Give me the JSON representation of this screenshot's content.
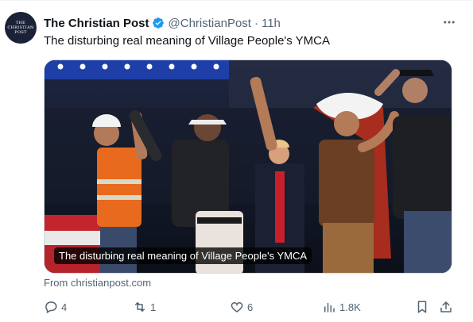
{
  "tweet": {
    "avatar_logo": "THE CHRISTIAN POST",
    "display_name": "The Christian Post",
    "handle": "@ChristianPost",
    "separator": "·",
    "time": "11h",
    "text": "The disturbing real meaning of Village People's YMCA",
    "card_caption": "The disturbing real meaning of Village People's YMCA",
    "card_image_icon": "photo-of-performers-on-stage",
    "source": "From christianpost.com",
    "more_icon": "more-horizontal-icon"
  },
  "actions": {
    "replies": "4",
    "retweets": "1",
    "likes": "6",
    "views": "1.8K",
    "bookmark_icon": "bookmark-icon",
    "share_icon": "share-icon"
  },
  "colors": {
    "text": "#0f1419",
    "secondary": "#536471",
    "verified": "#1d9bf0",
    "avatar_bg": "#1b2238"
  }
}
